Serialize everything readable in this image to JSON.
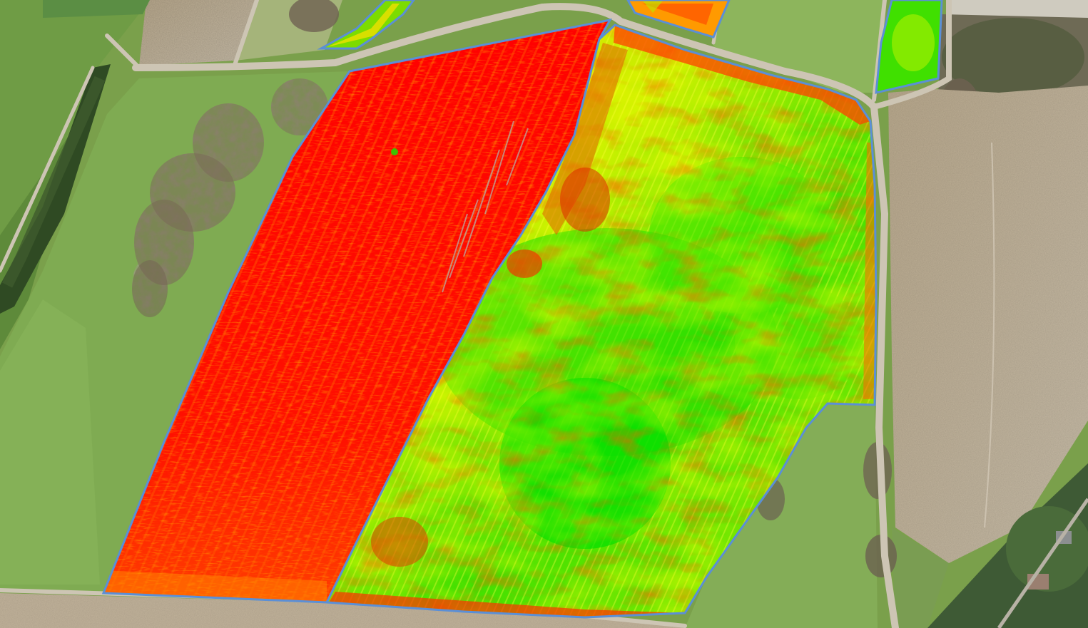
{
  "map": {
    "view": "aerial-satellite",
    "overlay": "vegetation-index-heatmap",
    "colors": {
      "index_low": "#ff0000",
      "index_low_mid": "#ff8a00",
      "index_mid": "#ffff00",
      "index_high": "#00e000",
      "field_boundary": "#5b8fd6",
      "grass": "#7fa64e",
      "grass_dark": "#5f8a3a",
      "bare_soil": "#b7a78d",
      "road": "#cfc6b6",
      "trees": "#7d6b56"
    },
    "fields": [
      {
        "id": "field-west",
        "dominant_index": "low"
      },
      {
        "id": "field-east",
        "dominant_index": "mixed-high"
      },
      {
        "id": "field-north-1",
        "dominant_index": "high"
      },
      {
        "id": "field-north-2",
        "dominant_index": "mixed"
      },
      {
        "id": "field-north-3",
        "dominant_index": "high"
      }
    ]
  }
}
